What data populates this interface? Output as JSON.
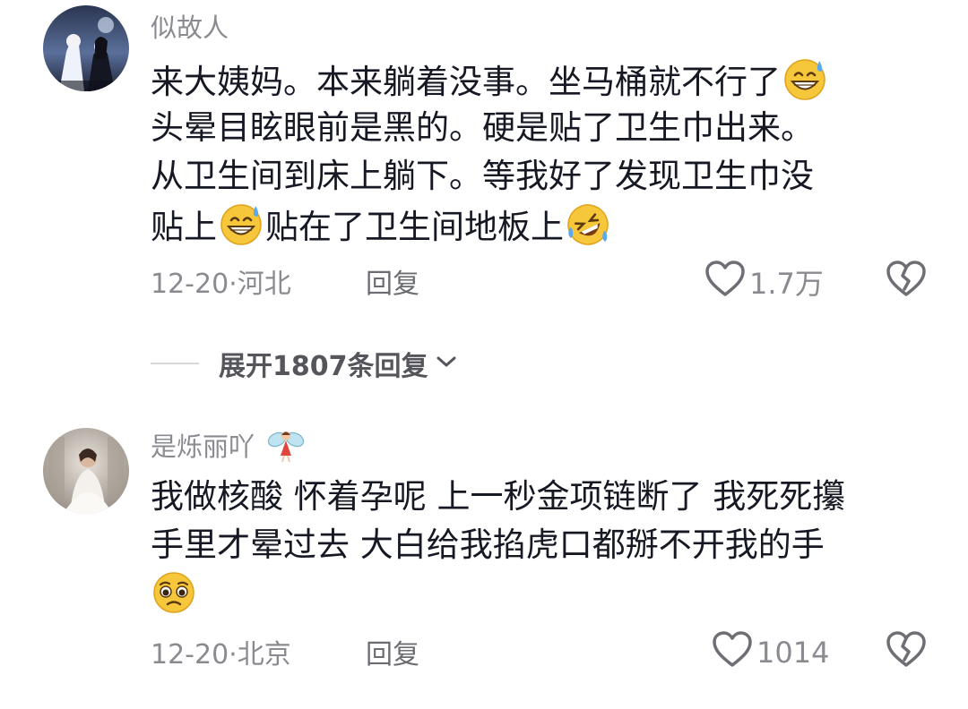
{
  "comments": [
    {
      "username": "似故人",
      "lines": [
        {
          "parts": [
            "来大姨妈。本来躺着没事。坐马桶就不行了"
          ],
          "emoji_after": "grin-sweat-emoji"
        },
        {
          "parts": [
            "头晕目眩眼前是黑的。硬是贴了卫生巾出来。"
          ]
        },
        {
          "parts": [
            "从卫生间到床上躺下。等我好了发现卫生巾没"
          ]
        },
        {
          "parts": [
            "贴上",
            "贴在了卫生间地板上"
          ]
        }
      ],
      "date_location": "12-20·河北",
      "reply_label": "回复",
      "like_count": "1.7万"
    },
    {
      "username": "是烁丽吖",
      "lines": [
        {
          "parts": [
            "我做核酸 怀着孕呢 上一秒金项链断了 我死死攥"
          ]
        },
        {
          "parts": [
            "手里才晕过去 大白给我掐虎口都掰不开我的手"
          ]
        }
      ],
      "date_location": "12-20·北京",
      "reply_label": "回复",
      "like_count": "1014"
    }
  ],
  "expand_replies_label": "展开1807条回复",
  "icons": [
    "heart-outline-icon",
    "broken-heart-icon",
    "chevron-down-icon",
    "grin-sweat-emoji",
    "rofl-emoji",
    "pleading-emoji",
    "fairy-emoji"
  ]
}
